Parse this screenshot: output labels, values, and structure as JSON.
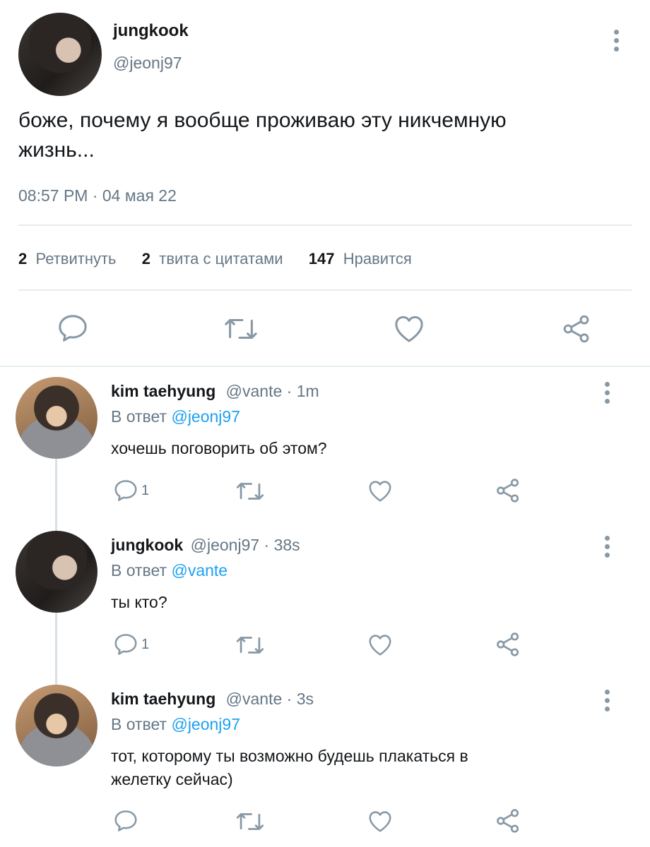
{
  "main_tweet": {
    "display_name": "jungkook",
    "handle": "@jeonj97",
    "text_line1": "боже, почему я вообще проживаю эту никчемную",
    "text_line2": "жизнь...",
    "timestamp": "08:57 PM · 04 мая 22",
    "stats": {
      "retweets_count": "2",
      "retweets_label": "Ретвитнуть",
      "quotes_count": "2",
      "quotes_label": "твита с цитатами",
      "likes_count": "147",
      "likes_label": "Нравится"
    }
  },
  "replies": [
    {
      "display_name": "kim taehyung",
      "handle": "@vante",
      "time": "· 1m",
      "reply_prefix": "В ответ",
      "reply_to": "@jeonj97",
      "text_line1": "хочешь поговорить об этом?",
      "text_line2": "",
      "reply_count": "1"
    },
    {
      "display_name": "jungkook",
      "handle": "@jeonj97",
      "time": "· 38s",
      "reply_prefix": "В ответ",
      "reply_to": "@vante",
      "text_line1": "ты кто?",
      "text_line2": "",
      "reply_count": "1"
    },
    {
      "display_name": "kim taehyung",
      "handle": "@vante",
      "time": "· 3s",
      "reply_prefix": "В ответ",
      "reply_to": "@jeonj97",
      "text_line1": "тот, которому ты возможно будешь плакаться в",
      "text_line2": "желетку сейчас)",
      "reply_count": ""
    }
  ],
  "icons": [
    "reply-icon",
    "retweet-icon",
    "like-icon",
    "share-icon",
    "more-options-icon"
  ],
  "colors": {
    "text": "#14171a",
    "muted": "#657786",
    "link": "#1da1f2",
    "icon": "#8899a6",
    "divider": "#e6ecf0"
  }
}
